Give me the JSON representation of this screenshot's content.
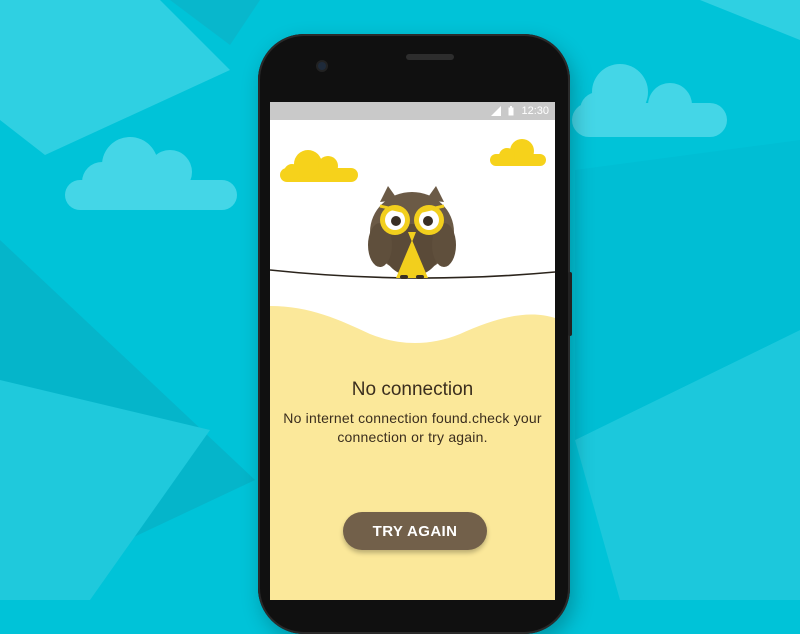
{
  "status_bar": {
    "time": "12:30",
    "icons": [
      "signal-icon",
      "battery-icon"
    ]
  },
  "error_screen": {
    "title": "No connection",
    "message": "No internet connection found.check your connection or try again.",
    "button_label": "TRY AGAIN"
  },
  "colors": {
    "background": "#00c3d8",
    "cloud_background": "#4fd7e6",
    "cloud_yellow": "#f6d21b",
    "sand": "#fbe89a",
    "owl_brown": "#6b5a46",
    "owl_yellow": "#f2cf1d",
    "button": "#72604a"
  }
}
